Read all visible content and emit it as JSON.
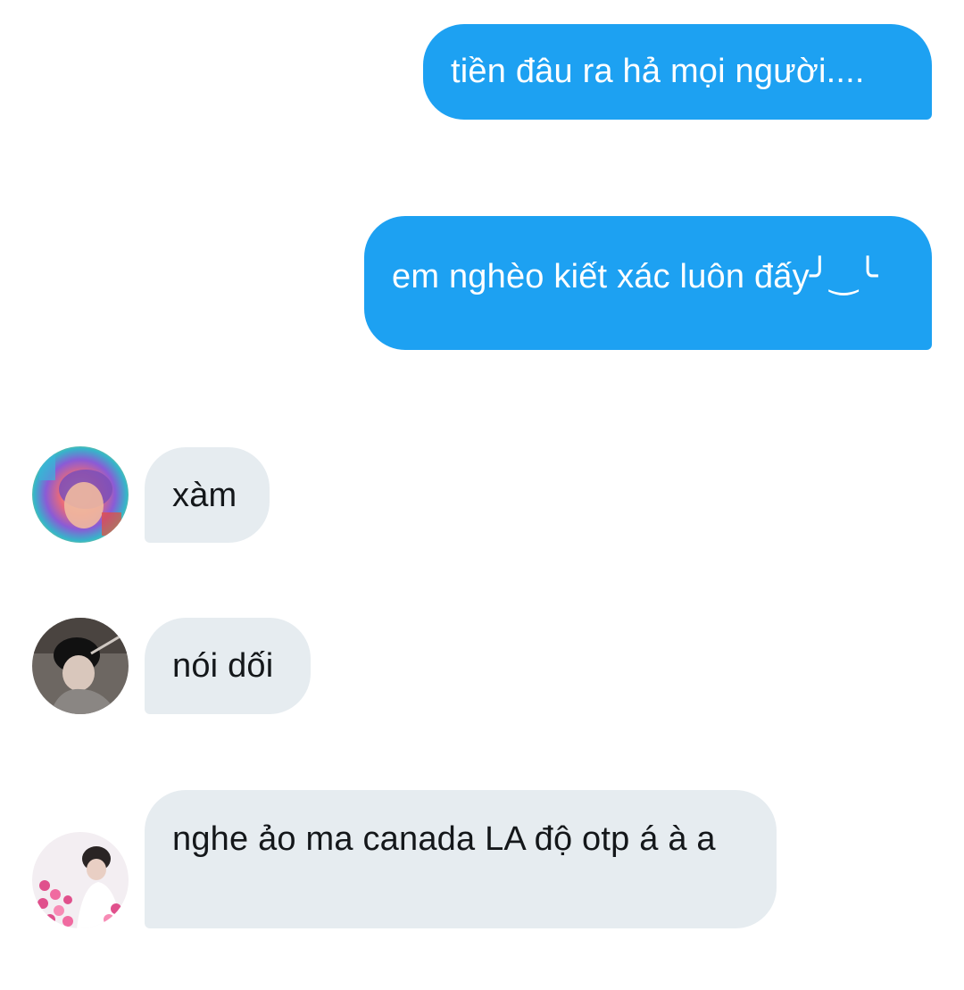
{
  "conversation": {
    "messages": [
      {
        "direction": "outgoing",
        "text": "tiền đâu ra hả mọi người...."
      },
      {
        "direction": "outgoing",
        "text": "em nghèo kiết xác luôn đấy╯‿╰"
      },
      {
        "direction": "incoming",
        "text": "xàm"
      },
      {
        "direction": "incoming",
        "text": "nói dối"
      },
      {
        "direction": "incoming",
        "text": "nghe ảo ma canada LA độ otp á à a"
      }
    ]
  },
  "colors": {
    "outgoing_bubble": "#1da1f2",
    "incoming_bubble": "#e6ecf0",
    "outgoing_text": "#ffffff",
    "incoming_text": "#14171a",
    "background": "#ffffff"
  },
  "avatars": [
    {
      "icon": "user-avatar-rainbow"
    },
    {
      "icon": "user-avatar-dark"
    },
    {
      "icon": "user-avatar-hearts"
    }
  ]
}
